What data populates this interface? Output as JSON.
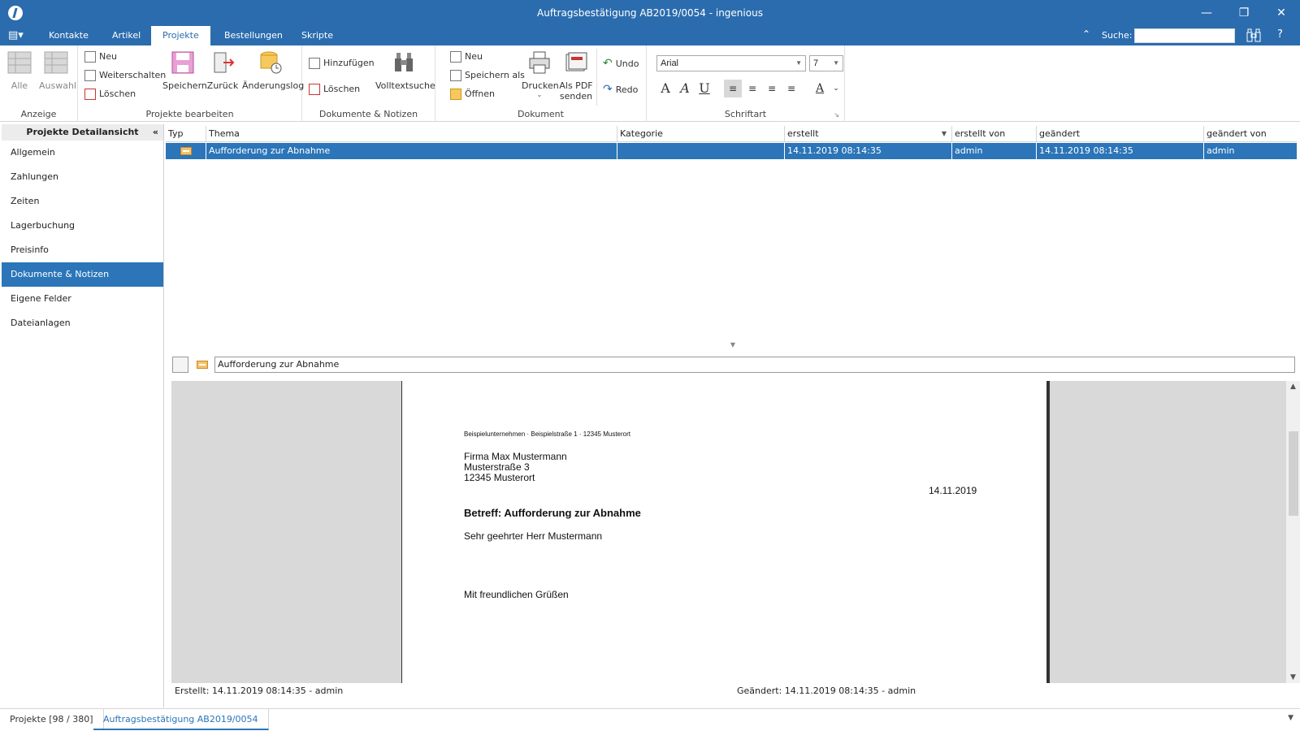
{
  "window": {
    "title": "Auftragsbestätigung AB2019/0054 - ingenious"
  },
  "menu": {
    "tabs": [
      {
        "label": "Kontakte"
      },
      {
        "label": "Artikel"
      },
      {
        "label": "Projekte",
        "active": true
      },
      {
        "label": "Bestellungen"
      },
      {
        "label": "Skripte"
      }
    ],
    "search_label": "Suche:",
    "search_value": "",
    "help_label": "?"
  },
  "ribbon": {
    "anzeige": {
      "label": "Anzeige",
      "alle": "Alle",
      "auswahl": "Auswahl"
    },
    "projekte": {
      "label": "Projekte bearbeiten",
      "neu": "Neu",
      "weiterschalten": "Weiterschalten",
      "loeschen": "Löschen",
      "speichern": "Speichern",
      "zurueck": "Zurück",
      "aenderungslog": "Änderungslog"
    },
    "dokumente": {
      "label": "Dokumente & Notizen",
      "hinzufuegen": "Hinzufügen",
      "loeschen": "Löschen",
      "volltextsuche": "Volltextsuche"
    },
    "dokument": {
      "label": "Dokument",
      "neu": "Neu",
      "speichern_als": "Speichern als",
      "oeffnen": "Öffnen",
      "drucken": "Drucken",
      "pdf_line1": "Als PDF",
      "pdf_line2": "senden",
      "undo": "Undo",
      "redo": "Redo"
    },
    "schriftart": {
      "label": "Schriftart",
      "font": "Arial",
      "size": "7"
    }
  },
  "sidebar": {
    "title": "Projekte Detailansicht",
    "items": [
      {
        "label": "Allgemein"
      },
      {
        "label": "Zahlungen"
      },
      {
        "label": "Zeiten"
      },
      {
        "label": "Lagerbuchung"
      },
      {
        "label": "Preisinfo"
      },
      {
        "label": "Dokumente & Notizen",
        "active": true
      },
      {
        "label": "Eigene Felder"
      },
      {
        "label": "Dateianlagen"
      }
    ]
  },
  "grid": {
    "columns": [
      "Typ",
      "Thema",
      "Kategorie",
      "erstellt",
      "erstellt von",
      "geändert",
      "geändert von"
    ],
    "rows": [
      {
        "thema": "Aufforderung zur Abnahme",
        "kategorie": "",
        "erstellt": "14.11.2019 08:14:35",
        "erstellt_von": "admin",
        "geaendert": "14.11.2019 08:14:35",
        "geaendert_von": "admin"
      }
    ]
  },
  "editor": {
    "subject": "Aufforderung zur Abnahme"
  },
  "document": {
    "sender": "Beispielunternehmen · Beispielstraße 1 · 12345 Musterort",
    "recipient": [
      "Firma Max Mustermann",
      "Musterstraße 3",
      "12345 Musterort"
    ],
    "date": "14.11.2019",
    "subject": "Betreff: Aufforderung zur Abnahme",
    "greeting": "Sehr geehrter Herr Mustermann",
    "closing": "Mit freundlichen Grüßen"
  },
  "status": {
    "created": "Erstellt: 14.11.2019 08:14:35 - admin",
    "changed": "Geändert: 14.11.2019 08:14:35 - admin"
  },
  "bottom_tabs": [
    {
      "label": "Projekte [98 / 380]"
    },
    {
      "label": "Auftragsbestätigung AB2019/0054",
      "active": true
    }
  ]
}
